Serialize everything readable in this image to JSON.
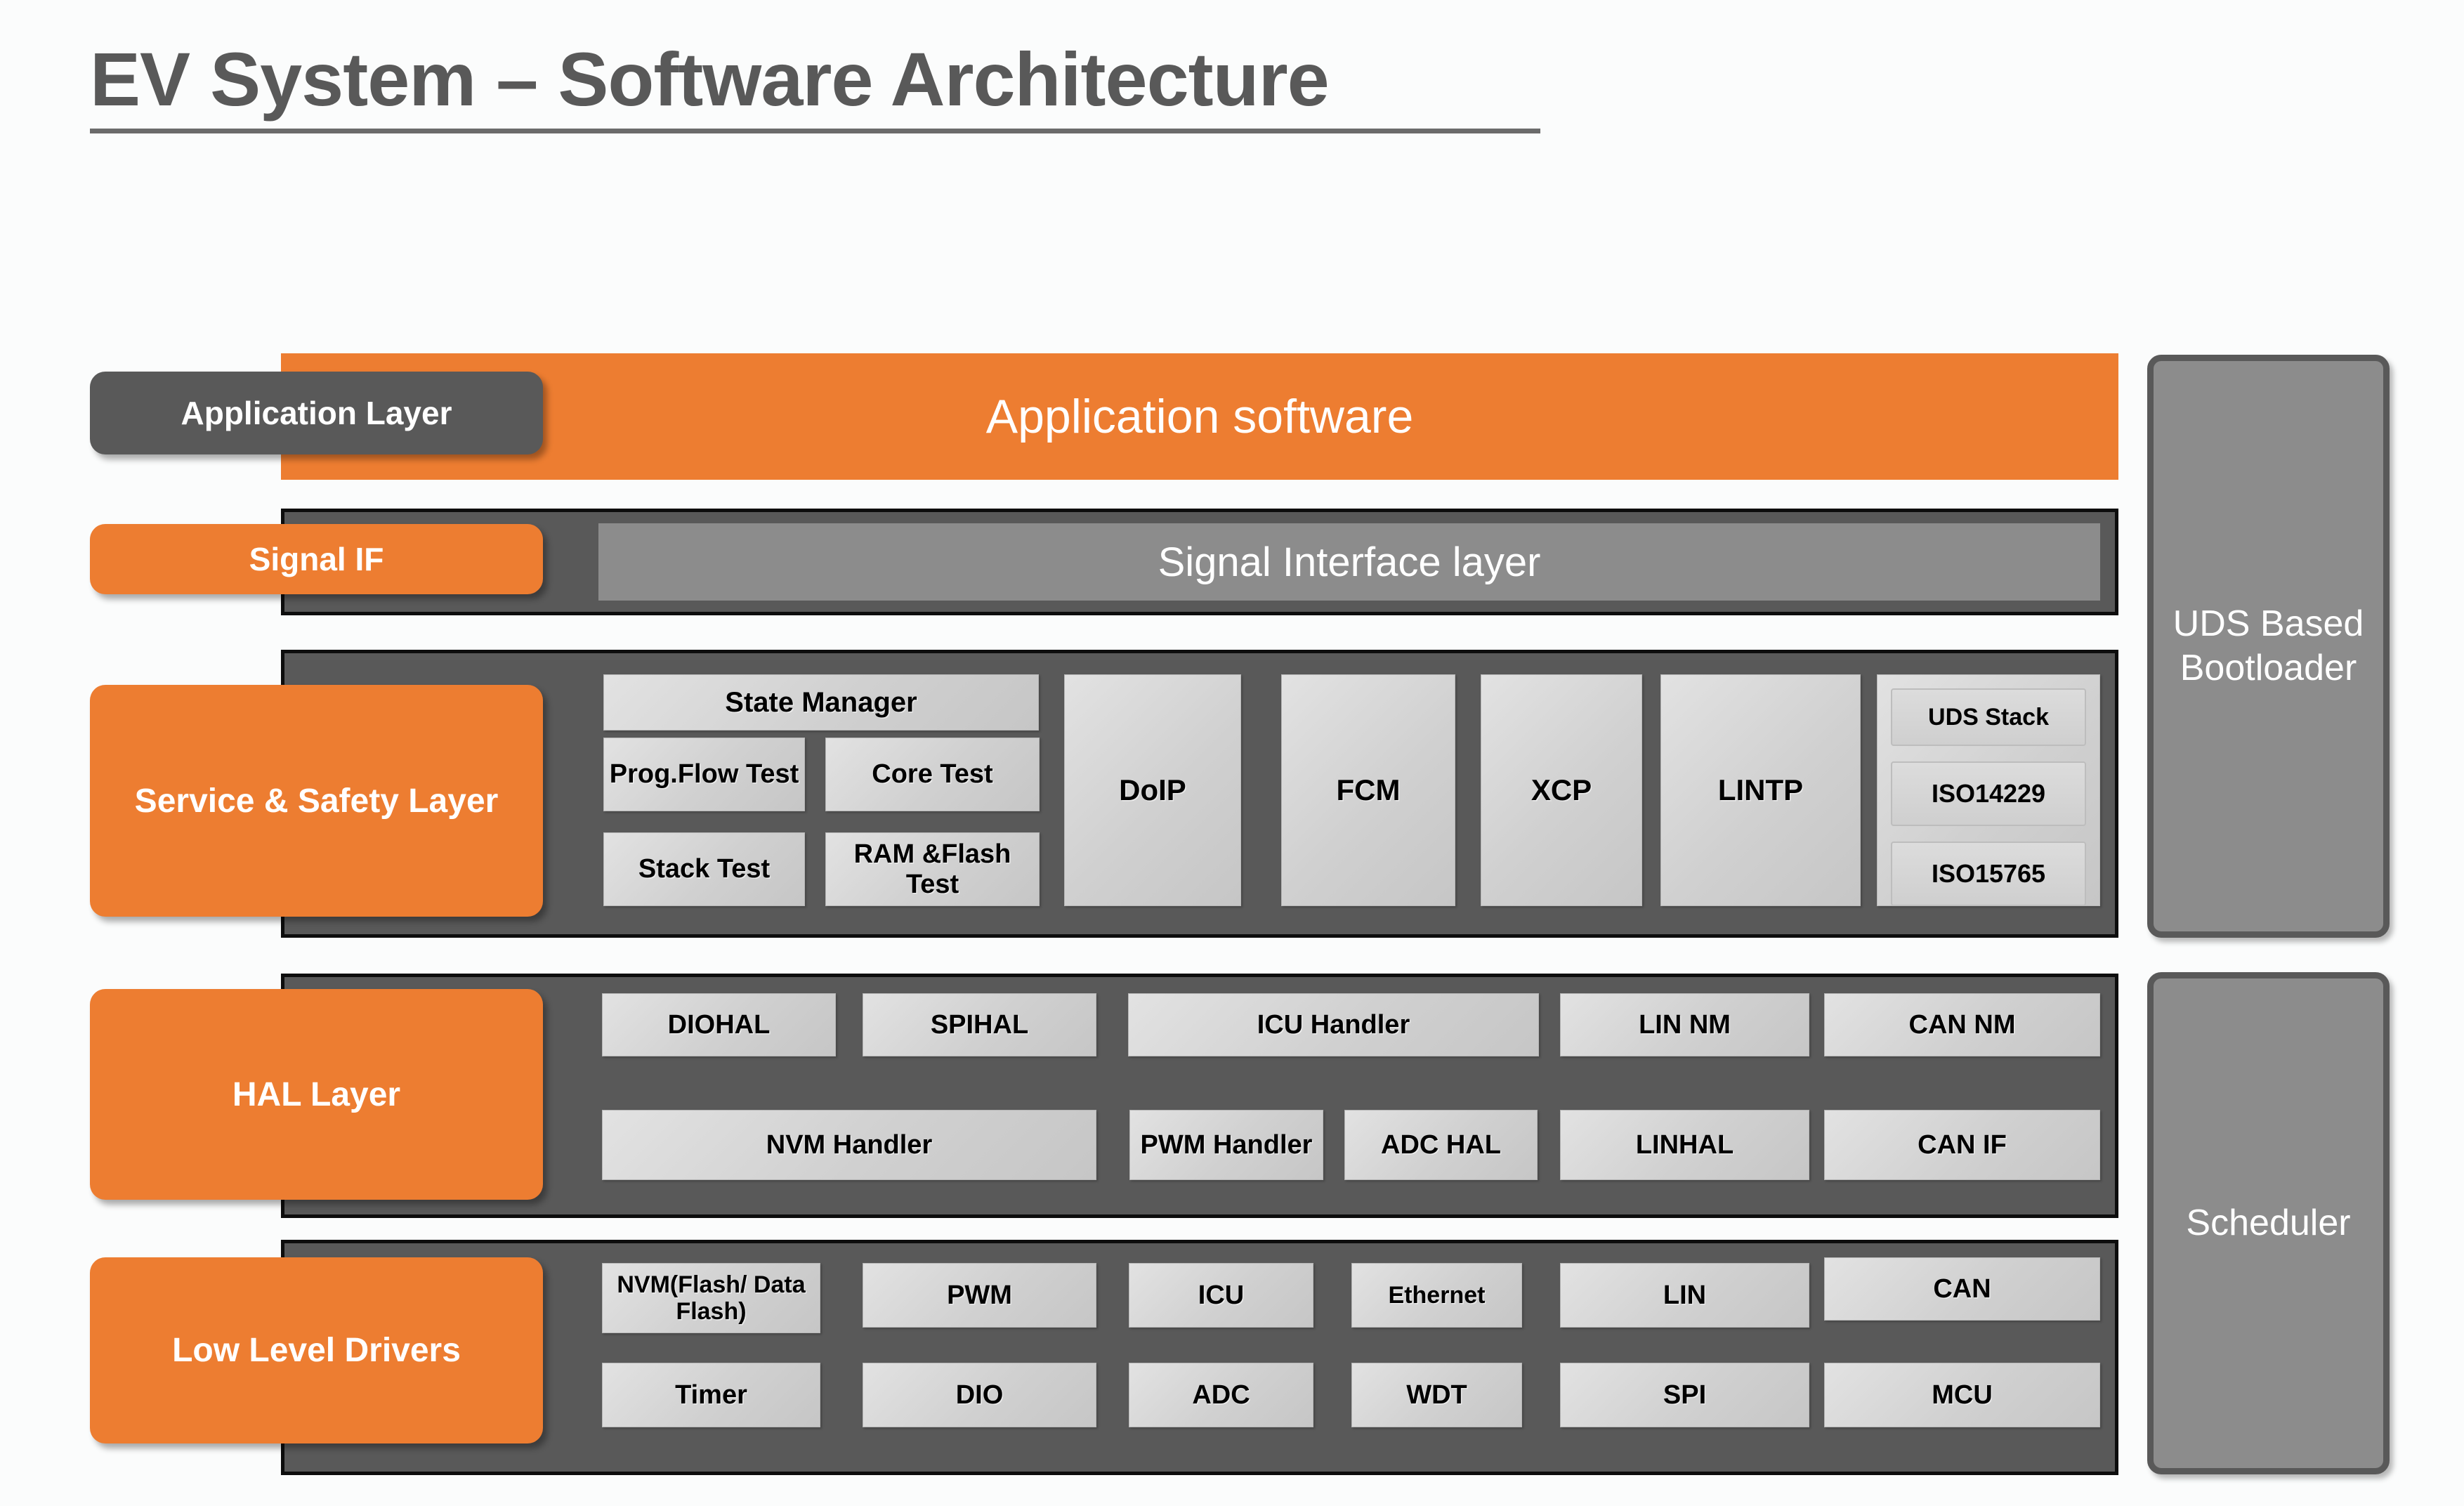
{
  "page": {
    "title": "EV System – Software Architecture",
    "background_color": "#fbfcfc",
    "accent_orange": "#ED7D31",
    "dark_gray": "#595959",
    "panel_gray": "#8c8c8c",
    "module_gray": "#d0d0d0"
  },
  "layer_tags": {
    "application": "Application Layer",
    "signal_if": "Signal IF",
    "service_safety": "Service & Safety Layer",
    "hal": "HAL Layer",
    "low_level": "Low Level Drivers"
  },
  "bars": {
    "application_software": "Application software",
    "signal_interface_layer": "Signal Interface layer"
  },
  "service_safety_layer": {
    "state_manager": "State Manager",
    "tests": [
      "Prog.Flow Test",
      "Core Test",
      "Stack Test",
      "RAM &Flash Test"
    ],
    "protocols": [
      "DoIP",
      "FCM",
      "XCP",
      "LINTP"
    ],
    "uds_group": [
      "UDS Stack",
      "ISO14229",
      "ISO15765"
    ]
  },
  "hal_layer": {
    "row1": [
      "DIOHAL",
      "SPIHAL",
      "ICU Handler",
      "LIN NM",
      "CAN NM"
    ],
    "row2": [
      "NVM Handler",
      "PWM Handler",
      "ADC HAL",
      "LINHAL",
      "CAN IF"
    ]
  },
  "low_level_drivers": {
    "row1": [
      "NVM(Flash/ Data Flash)",
      "PWM",
      "ICU",
      "Ethernet",
      "LIN",
      "CAN"
    ],
    "row2": [
      "Timer",
      "DIO",
      "ADC",
      "WDT",
      "SPI",
      "MCU"
    ]
  },
  "side_panels": {
    "bootloader": "UDS Based Bootloader",
    "scheduler": "Scheduler"
  }
}
